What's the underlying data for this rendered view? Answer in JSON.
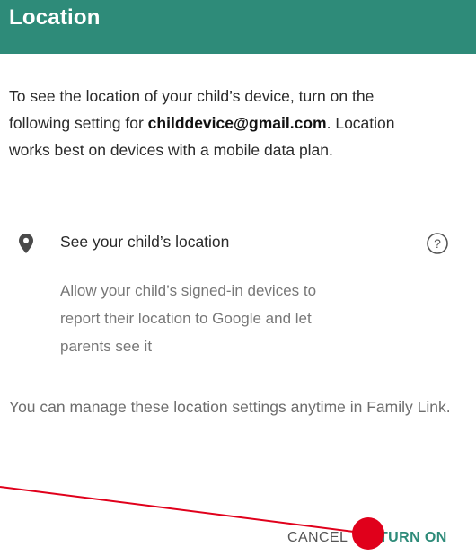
{
  "appbar": {
    "title": "Location"
  },
  "intro": {
    "prefix": "To see the location of your child’s device, turn on the following setting for ",
    "email": "childdevice@gmail.com",
    "suffix": ". Location works best on devices with a mobile data plan."
  },
  "setting": {
    "icon": "location-pin-icon",
    "title": "See your child’s location",
    "help_icon": "help-circle-icon",
    "description": "Allow your child’s signed-in devices to report their location to Google and let parents see it"
  },
  "footer": {
    "text": "You can manage these location settings anytime in Family Link."
  },
  "actions": {
    "cancel_label": "CANCEL",
    "turn_on_label": "TURN ON"
  },
  "colors": {
    "accent": "#2e8b79",
    "annotation": "#e0001b"
  }
}
